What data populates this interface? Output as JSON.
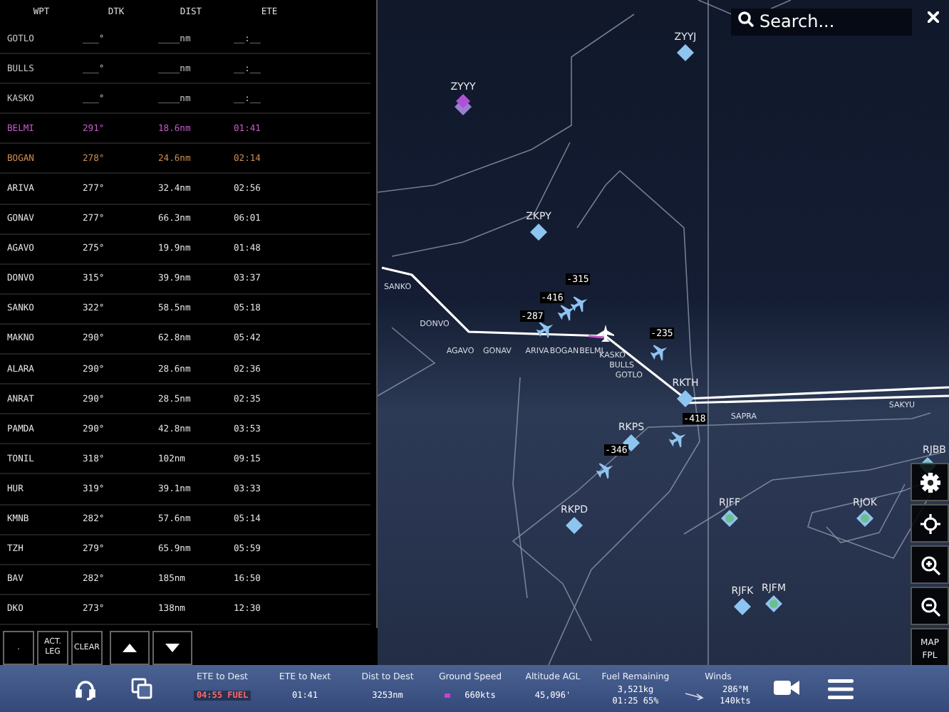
{
  "flight_plan": {
    "columns": [
      "WPT",
      "DTK",
      "DIST",
      "ETE"
    ],
    "rows": [
      {
        "wpt": "GOTLO",
        "dtk": "___°",
        "dist": "____nm",
        "ete": "__:__",
        "kind": "pending"
      },
      {
        "wpt": "BULLS",
        "dtk": "___°",
        "dist": "____nm",
        "ete": "__:__",
        "kind": "pending"
      },
      {
        "wpt": "KASKO",
        "dtk": "___°",
        "dist": "____nm",
        "ete": "__:__",
        "kind": "pending"
      },
      {
        "wpt": "BELMI",
        "dtk": "291°",
        "dist": "18.6nm",
        "ete": "01:41",
        "kind": "active"
      },
      {
        "wpt": "BOGAN",
        "dtk": "278°",
        "dist": "24.6nm",
        "ete": "02:14",
        "kind": "next"
      },
      {
        "wpt": "ARIVA",
        "dtk": "277°",
        "dist": "32.4nm",
        "ete": "02:56",
        "kind": "normal"
      },
      {
        "wpt": "GONAV",
        "dtk": "277°",
        "dist": "66.3nm",
        "ete": "06:01",
        "kind": "normal"
      },
      {
        "wpt": "AGAVO",
        "dtk": "275°",
        "dist": "19.9nm",
        "ete": "01:48",
        "kind": "normal"
      },
      {
        "wpt": "DONVO",
        "dtk": "315°",
        "dist": "39.9nm",
        "ete": "03:37",
        "kind": "normal"
      },
      {
        "wpt": "SANKO",
        "dtk": "322°",
        "dist": "58.5nm",
        "ete": "05:18",
        "kind": "normal"
      },
      {
        "wpt": "MAKNO",
        "dtk": "290°",
        "dist": "62.8nm",
        "ete": "05:42",
        "kind": "normal"
      },
      {
        "wpt": "ALARA",
        "dtk": "290°",
        "dist": "28.6nm",
        "ete": "02:36",
        "kind": "normal"
      },
      {
        "wpt": "ANRAT",
        "dtk": "290°",
        "dist": "28.5nm",
        "ete": "02:35",
        "kind": "normal"
      },
      {
        "wpt": "PAMDA",
        "dtk": "290°",
        "dist": "42.8nm",
        "ete": "03:53",
        "kind": "normal"
      },
      {
        "wpt": "TONIL",
        "dtk": "318°",
        "dist": "102nm",
        "ete": "09:15",
        "kind": "normal"
      },
      {
        "wpt": "HUR",
        "dtk": "319°",
        "dist": "39.1nm",
        "ete": "03:33",
        "kind": "normal"
      },
      {
        "wpt": "KMNB",
        "dtk": "282°",
        "dist": "57.6nm",
        "ete": "05:14",
        "kind": "normal"
      },
      {
        "wpt": "TZH",
        "dtk": "279°",
        "dist": "65.9nm",
        "ete": "05:59",
        "kind": "normal"
      },
      {
        "wpt": "BAV",
        "dtk": "282°",
        "dist": "185nm",
        "ete": "16:50",
        "kind": "normal"
      },
      {
        "wpt": "DKO",
        "dtk": "273°",
        "dist": "138nm",
        "ete": "12:30",
        "kind": "normal"
      }
    ],
    "buttons": [
      {
        "kind": "text",
        "label": "."
      },
      {
        "kind": "text",
        "label": "ACT. LEG"
      },
      {
        "kind": "text",
        "label": "CLEAR"
      },
      {
        "kind": "up"
      },
      {
        "kind": "down"
      }
    ]
  },
  "search": {
    "placeholder": "Search..."
  },
  "map": {
    "airports": [
      {
        "name": "ZYYJ",
        "kind": "major"
      },
      {
        "name": "ZYYY",
        "kind": "highlight"
      },
      {
        "name": "ZKPY",
        "kind": "major"
      },
      {
        "name": "RKTH",
        "kind": "major"
      },
      {
        "name": "RKPS",
        "kind": "major"
      },
      {
        "name": "RKPD",
        "kind": "major"
      },
      {
        "name": "RJFF",
        "kind": "minor"
      },
      {
        "name": "RJOK",
        "kind": "minor"
      },
      {
        "name": "RJFK",
        "kind": "major"
      },
      {
        "name": "RJFM",
        "kind": "minor"
      },
      {
        "name": "RJBB",
        "kind": "minor"
      }
    ],
    "waypoints": [
      "SANKO",
      "DONVO",
      "AGAVO",
      "GONAV",
      "ARIVA",
      "BOGAN",
      "BELMI",
      "KASKO",
      "BULLS",
      "GOTLO",
      "SAPRA",
      "SAKYU"
    ],
    "traffic": [
      {
        "altitude": "-315"
      },
      {
        "altitude": "-416"
      },
      {
        "altitude": "-287"
      },
      {
        "altitude": "-235"
      },
      {
        "altitude": "-418"
      },
      {
        "altitude": "-346"
      }
    ],
    "controls": [
      {
        "kind": "settings"
      },
      {
        "kind": "recenter"
      },
      {
        "kind": "zoom-in"
      },
      {
        "kind": "zoom-out"
      },
      {
        "kind": "text",
        "label": "MAP FPL"
      }
    ]
  },
  "status_bar": {
    "stats": [
      {
        "label": "ETE to Dest",
        "values": [
          "04:55 FUEL"
        ],
        "alert": true,
        "kind": "plain"
      },
      {
        "label": "ETE to Next",
        "values": [
          "01:41"
        ],
        "alert": false,
        "kind": "plain"
      },
      {
        "label": "Dist to Dest",
        "values": [
          "3253nm"
        ],
        "alert": false,
        "kind": "plain"
      },
      {
        "label": "Ground Speed",
        "values": [
          "660kts"
        ],
        "alert": false,
        "kind": "trend"
      },
      {
        "label": "Altitude AGL",
        "values": [
          "45,096'"
        ],
        "alert": false,
        "kind": "plain"
      },
      {
        "label": "Fuel Remaining",
        "values": [
          "3,521kg",
          "01:25 65%"
        ],
        "alert": false,
        "kind": "plain"
      },
      {
        "label": "Winds",
        "values": [
          "286°M",
          "140kts"
        ],
        "alert": false,
        "kind": "wind"
      }
    ]
  }
}
